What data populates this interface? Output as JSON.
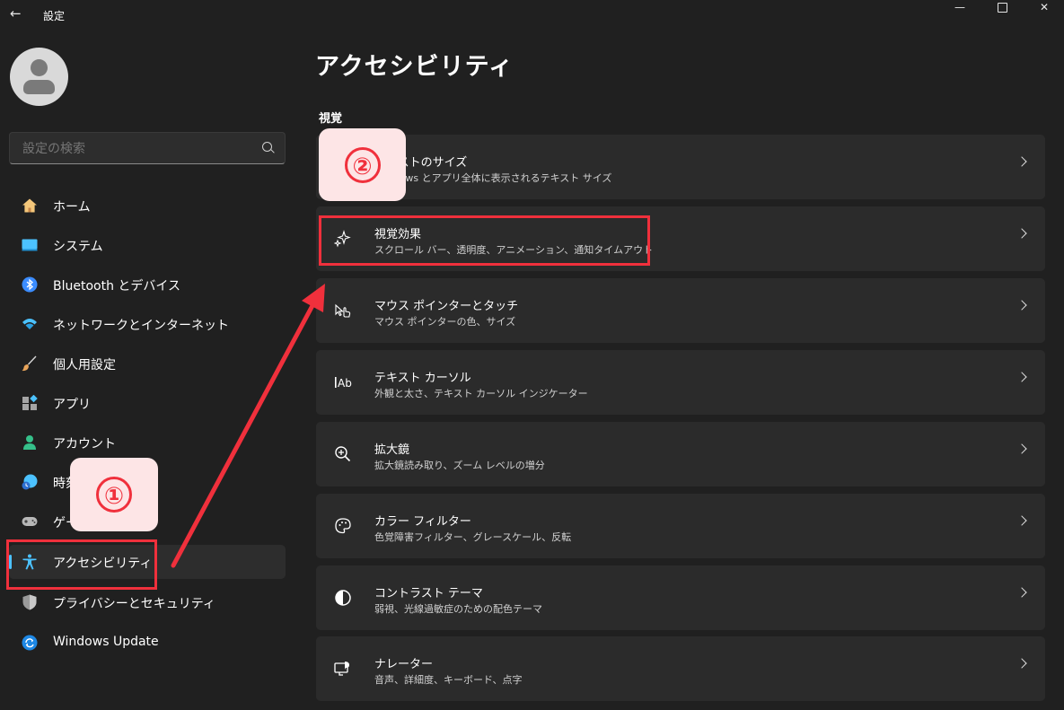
{
  "titlebar": {
    "back_label": "←",
    "app_title": "設定"
  },
  "search": {
    "placeholder": "設定の検索",
    "value": ""
  },
  "sidebar": {
    "items": [
      {
        "label": "ホーム",
        "icon": "home-icon",
        "active": false
      },
      {
        "label": "システム",
        "icon": "system-icon",
        "active": false
      },
      {
        "label": "Bluetooth とデバイス",
        "icon": "bluetooth-icon",
        "active": false
      },
      {
        "label": "ネットワークとインターネット",
        "icon": "wifi-icon",
        "active": false
      },
      {
        "label": "個人用設定",
        "icon": "brush-icon",
        "active": false
      },
      {
        "label": "アプリ",
        "icon": "apps-icon",
        "active": false
      },
      {
        "label": "アカウント",
        "icon": "account-icon",
        "active": false
      },
      {
        "label": "時刻と言語",
        "icon": "time-language-icon",
        "active": false
      },
      {
        "label": "ゲーム",
        "icon": "gaming-icon",
        "active": false
      },
      {
        "label": "アクセシビリティ",
        "icon": "accessibility-icon",
        "active": true
      },
      {
        "label": "プライバシーとセキュリティ",
        "icon": "shield-icon",
        "active": false
      },
      {
        "label": "Windows Update",
        "icon": "update-icon",
        "active": false
      }
    ]
  },
  "main": {
    "title": "アクセシビリティ",
    "section": "視覚",
    "cards": [
      {
        "title": "テキストのサイズ",
        "subtitle": "Windows とアプリ全体に表示されるテキスト サイズ",
        "icon": "text-size-icon"
      },
      {
        "title": "視覚効果",
        "subtitle": "スクロール バー、透明度、アニメーション、通知タイムアウト",
        "icon": "visual-effects-icon"
      },
      {
        "title": "マウス ポインターとタッチ",
        "subtitle": "マウス ポインターの色、サイズ",
        "icon": "mouse-pointer-icon"
      },
      {
        "title": "テキスト カーソル",
        "subtitle": "外観と太さ、テキスト カーソル インジケーター",
        "icon": "text-cursor-icon"
      },
      {
        "title": "拡大鏡",
        "subtitle": "拡大鏡読み取り、ズーム レベルの増分",
        "icon": "magnifier-icon"
      },
      {
        "title": "カラー フィルター",
        "subtitle": "色覚障害フィルター、グレースケール、反転",
        "icon": "palette-icon"
      },
      {
        "title": "コントラスト テーマ",
        "subtitle": "弱視、光線過敏症のための配色テーマ",
        "icon": "contrast-icon"
      },
      {
        "title": "ナレーター",
        "subtitle": "音声、詳細度、キーボード、点字",
        "icon": "narrator-icon"
      }
    ]
  },
  "annotations": {
    "step1": "①",
    "step2": "②",
    "color": "#f0303c"
  },
  "colors": {
    "background": "#202020",
    "card": "#2b2b2b",
    "accent": "#4cc2ff"
  }
}
